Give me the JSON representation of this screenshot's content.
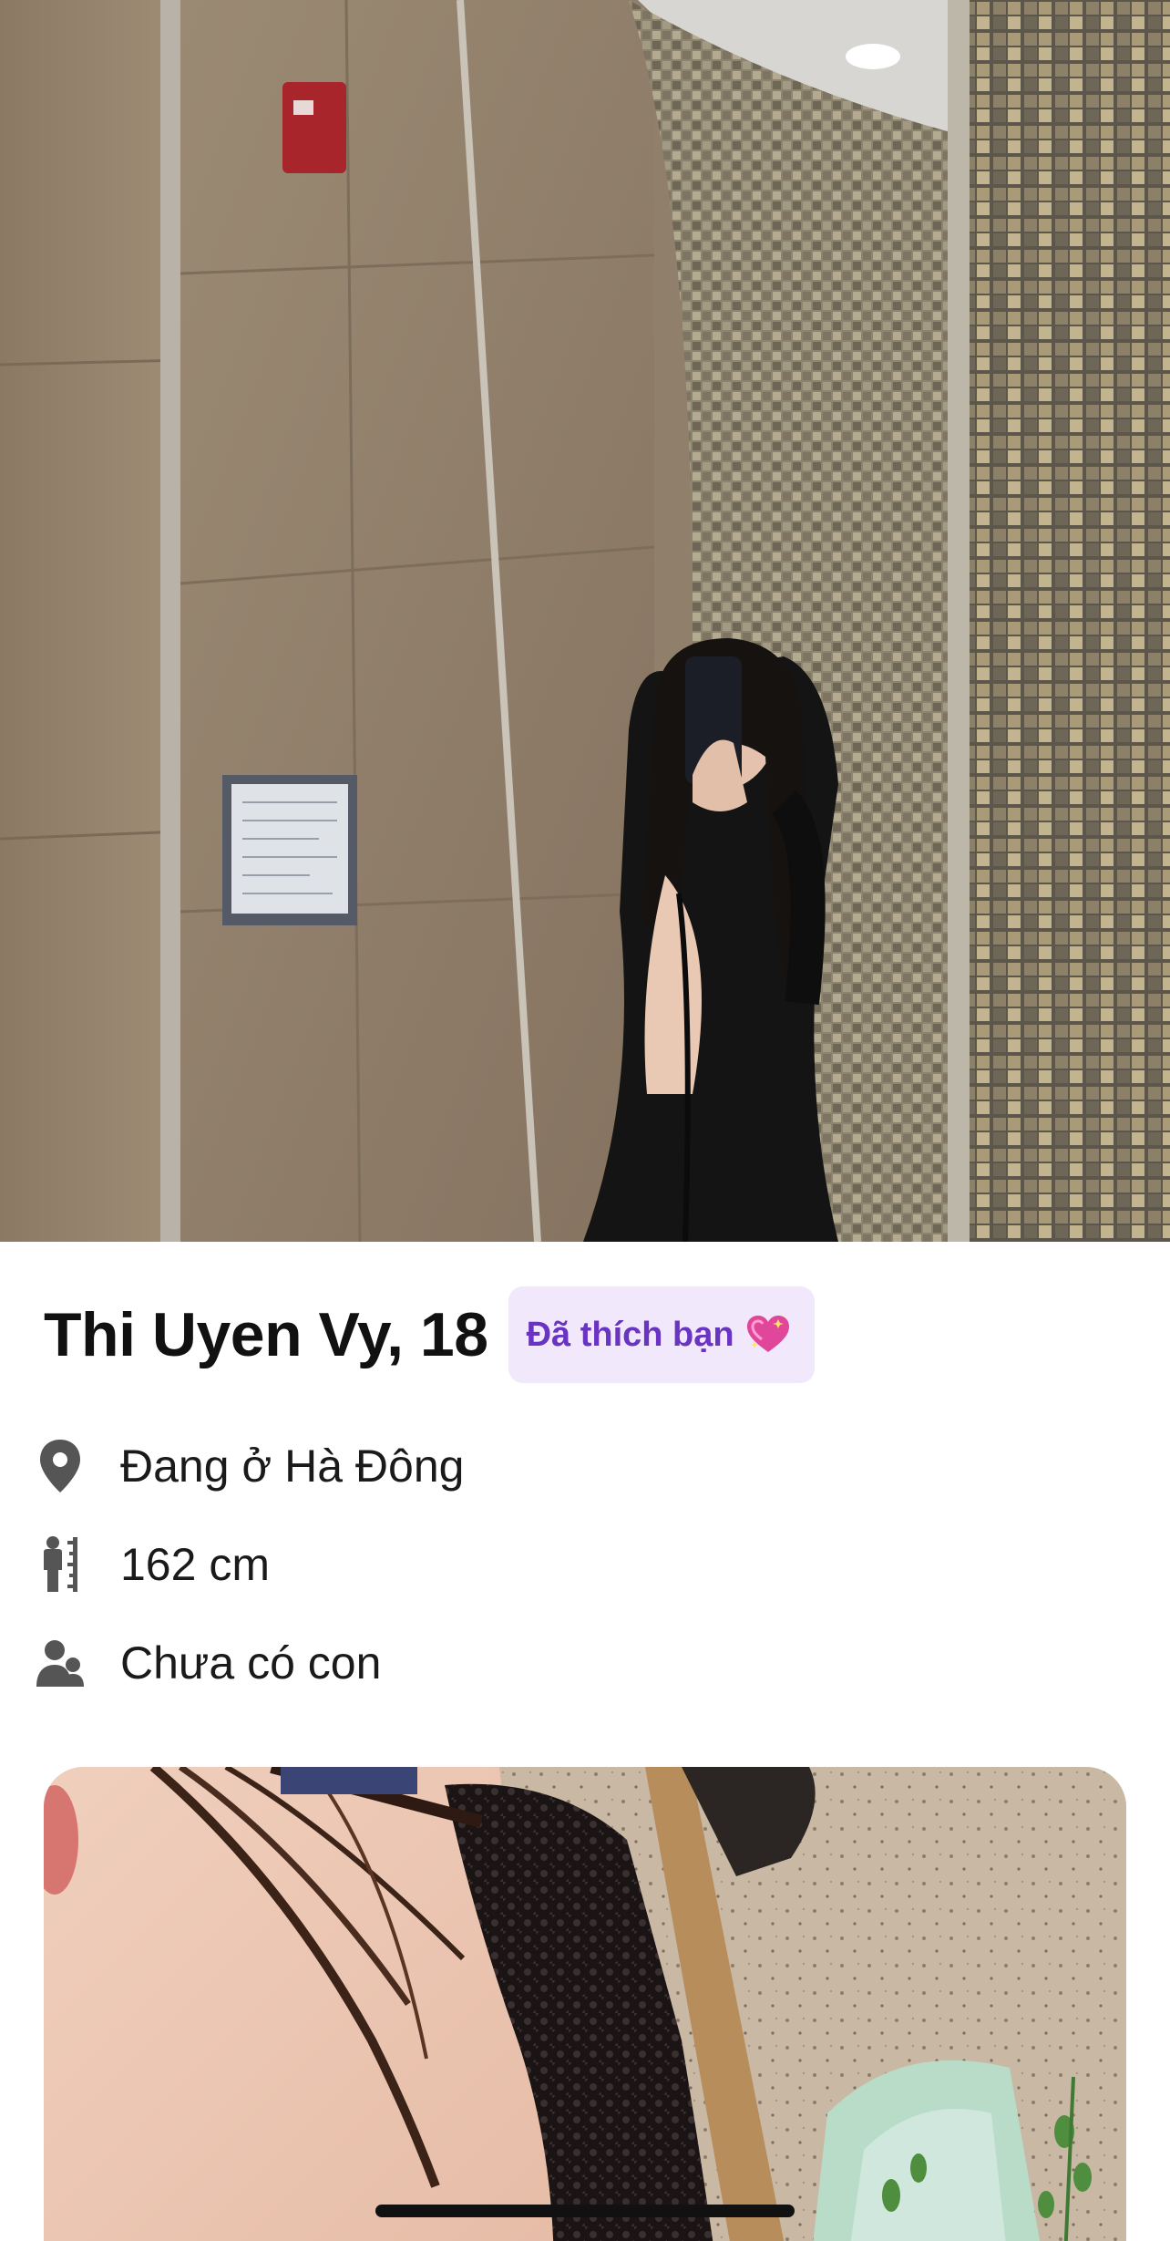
{
  "profile": {
    "name_age": "Thi Uyen Vy, 18",
    "like_badge": {
      "label": "Đã thích bạn",
      "emoji_icon": "sparkling-heart-icon",
      "background": "#f1e8fc",
      "text_color": "#6a34c2"
    },
    "details": [
      {
        "icon": "location-pin-icon",
        "text": "Đang ở Hà Đông"
      },
      {
        "icon": "height-ruler-icon",
        "text": "162 cm"
      },
      {
        "icon": "people-icon",
        "text": "Chưa có con"
      }
    ]
  },
  "photos": [
    {
      "label": "mirror-selfie-photo"
    },
    {
      "label": "second-profile-photo"
    }
  ],
  "colors": {
    "icon_gray": "#555555",
    "text_primary": "#111111"
  }
}
